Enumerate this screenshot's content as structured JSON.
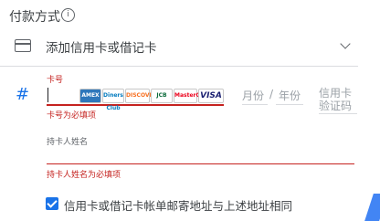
{
  "payment": {
    "title": "付款方式",
    "info_icon": "info-icon",
    "add_card_label": "添加信用卡或借记卡",
    "card_icon": "credit-card-icon",
    "dropdown_icon": "chevron-down-icon"
  },
  "card_number": {
    "label": "卡号",
    "error": "卡号为必填项",
    "hash_icon": "hash-icon",
    "hash_color": "#1a73e8",
    "brands": [
      "AMEX",
      "Diners Club",
      "DISCOVER",
      "JCB",
      "MasterCard",
      "VISA"
    ]
  },
  "expiry": {
    "month_placeholder": "月份",
    "separator": "/",
    "year_placeholder": "年份"
  },
  "cvc": {
    "placeholder": "信用卡验证码"
  },
  "cardholder": {
    "label": "持卡人姓名",
    "error": "持卡人姓名为必填项"
  },
  "billing": {
    "same_address_label": "信用卡或借记卡帐单邮寄地址与上述地址相同",
    "checked": true
  },
  "colors": {
    "error": "#c5221f",
    "accent": "#1a73e8",
    "text": "#3c4043"
  }
}
